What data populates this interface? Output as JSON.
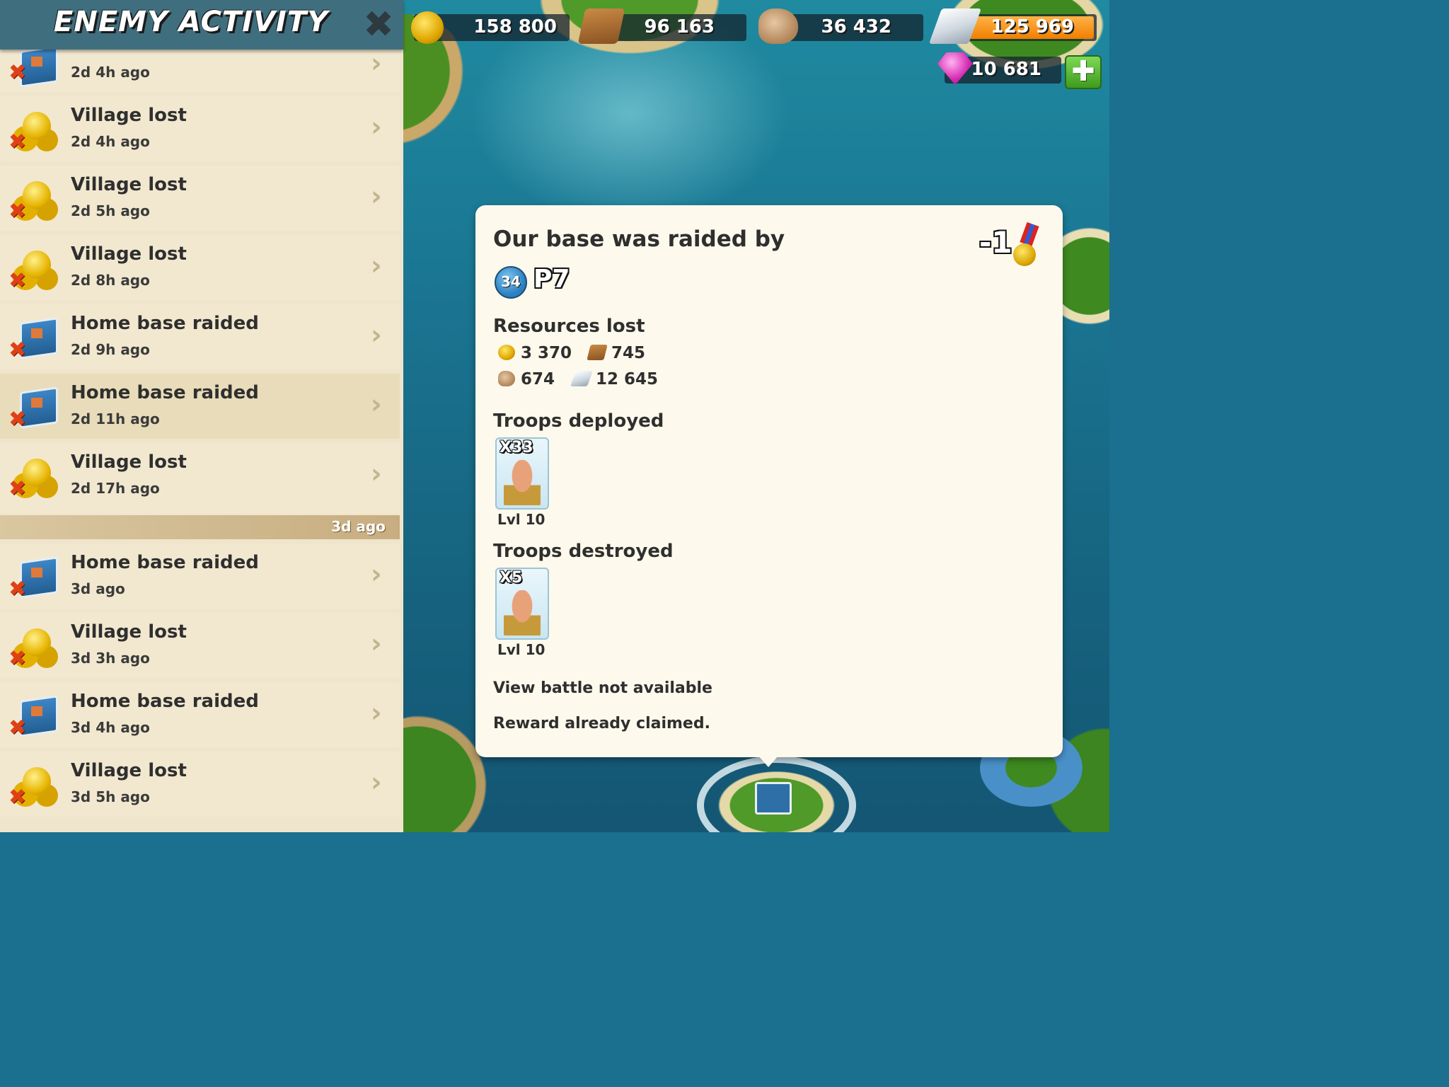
{
  "panel": {
    "title": "ENEMY ACTIVITY",
    "close_glyph": "✖",
    "partial_first_time": "2d 4h ago",
    "items": [
      {
        "title": "Village lost",
        "time": "2d 4h ago",
        "icon": "coins-icon"
      },
      {
        "title": "Village lost",
        "time": "2d 5h ago",
        "icon": "coins-icon"
      },
      {
        "title": "Village lost",
        "time": "2d 8h ago",
        "icon": "coins-icon"
      },
      {
        "title": "Home base raided",
        "time": "2d 9h ago",
        "icon": "headquarters-icon"
      },
      {
        "title": "Home base raided",
        "time": "2d 11h ago",
        "icon": "headquarters-icon",
        "selected": true
      },
      {
        "title": "Village lost",
        "time": "2d 17h ago",
        "icon": "coins-icon"
      }
    ],
    "separator_label": "3d ago",
    "items2": [
      {
        "title": "Home base raided",
        "time": "3d ago",
        "icon": "headquarters-icon"
      },
      {
        "title": "Village lost",
        "time": "3d 3h ago",
        "icon": "coins-icon"
      },
      {
        "title": "Home base raided",
        "time": "3d 4h ago",
        "icon": "headquarters-icon"
      },
      {
        "title": "Village lost",
        "time": "3d 5h ago",
        "icon": "coins-icon"
      }
    ]
  },
  "resources": {
    "gold": "158 800",
    "wood": "96 163",
    "stone": "36 432",
    "iron": "125 969",
    "gems": "10 681",
    "plus_glyph": "✚"
  },
  "detail": {
    "title": "Our base was raided by",
    "medal_change": "-1",
    "player_level": "34",
    "player_name": "P7",
    "resources_lost_label": "Resources lost",
    "lost": {
      "gold": "3 370",
      "wood": "745",
      "stone": "674",
      "iron": "12 645"
    },
    "troops_deployed_label": "Troops deployed",
    "deployed": {
      "count": "X33",
      "level": "Lvl 10"
    },
    "troops_destroyed_label": "Troops destroyed",
    "destroyed": {
      "count": "X5",
      "level": "Lvl 10"
    },
    "view_battle_note": "View battle not available",
    "reward_note": "Reward already claimed."
  },
  "colors": {
    "header": "#3f6e7f",
    "panel_bg": "#efe5cc",
    "popup_bg": "#fdf9ec",
    "loss_mark": "#e04016",
    "gem_plus": "#5bbf33"
  }
}
